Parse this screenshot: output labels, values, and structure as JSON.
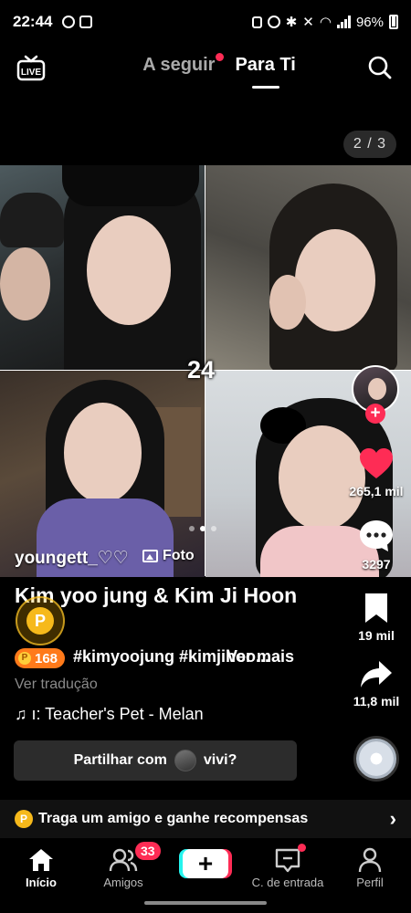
{
  "status_bar": {
    "time": "22:44",
    "battery": "96%"
  },
  "top_nav": {
    "tab_following": "A seguir",
    "tab_for_you": "Para Ti",
    "live_label": "LIVE"
  },
  "post": {
    "page_counter": "2 / 3",
    "collage_label": "24",
    "author": "youngett_♡♡",
    "media_type": "Foto",
    "title": "Kim yoo jung & Kim Ji Hoon",
    "hashtags": "#kimyoojung #kimjihoo...",
    "see_more": "Ver mais",
    "translate": "Ver tradução",
    "music": "♫ ı: Teacher's Pet - Melan",
    "points": "168",
    "coin_symbol": "P"
  },
  "actions": {
    "likes": "265,1 mil",
    "comments": "3297",
    "saves": "19 mil",
    "shares": "11,8 mil"
  },
  "share_prompt": {
    "prefix": "Partilhar com",
    "name": "vivi?"
  },
  "referral": {
    "text": "Traga um amigo e ganhe recompensas",
    "coin_symbol": "P"
  },
  "bottom_nav": {
    "home": "Início",
    "friends": "Amigos",
    "friends_badge": "33",
    "inbox": "C. de entrada",
    "profile": "Perfil"
  },
  "colors": {
    "accent": "#fe2c55",
    "cyan": "#25f4ee",
    "coin": "#f6b91b"
  }
}
